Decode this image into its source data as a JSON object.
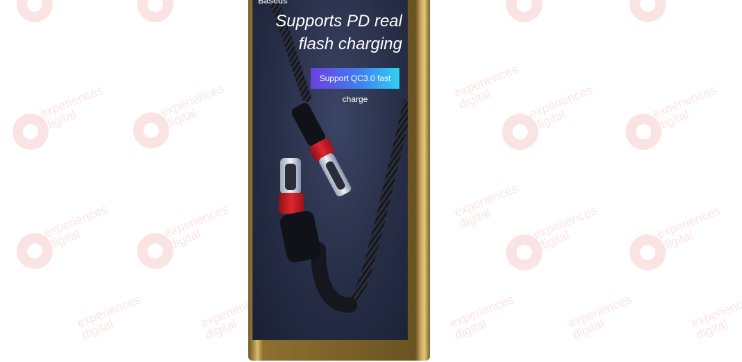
{
  "ad": {
    "brand": "Baseus",
    "headline_line1": "Supports PD real",
    "headline_line2": "flash charging",
    "badge": "Support QC3.0 fast charge"
  },
  "watermark": {
    "line1": "experiences",
    "line2": "digital"
  },
  "colors": {
    "background": "#ffffff",
    "phone_frame": "#c9ab5d",
    "screen": "#2a3150",
    "accent_red": "#d8202a",
    "watermark_red": "#e03a2f",
    "badge_start": "#6b3fe0",
    "badge_end": "#2fd1f2"
  }
}
